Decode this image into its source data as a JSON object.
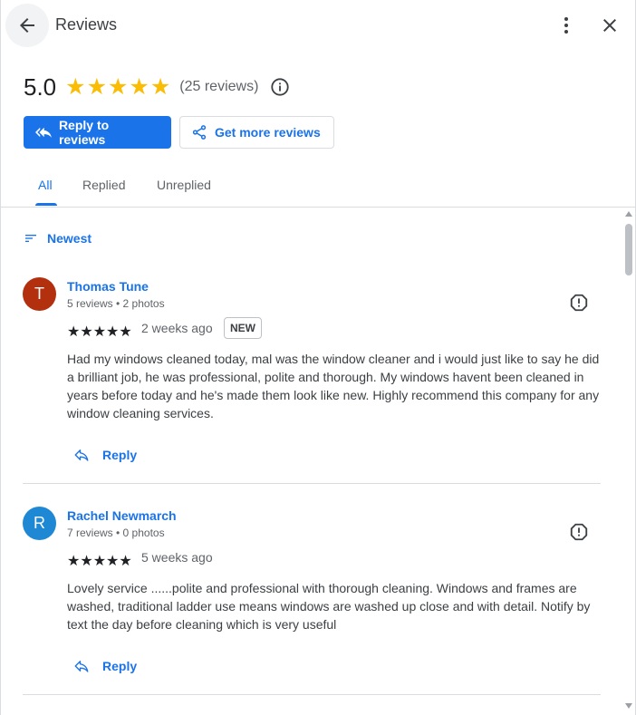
{
  "header": {
    "title": "Reviews",
    "back_icon": "arrow-back-icon",
    "more_icon": "more-vert-icon",
    "close_icon": "close-icon"
  },
  "summary": {
    "rating": "5.0",
    "stars": 5,
    "review_count": "(25 reviews)",
    "info_icon": "info-icon"
  },
  "actions": {
    "reply_to_reviews": "Reply to reviews",
    "get_more_reviews": "Get more reviews"
  },
  "tabs": [
    {
      "label": "All",
      "active": true
    },
    {
      "label": "Replied",
      "active": false
    },
    {
      "label": "Unreplied",
      "active": false
    }
  ],
  "sort": {
    "label": "Newest",
    "icon": "sort-icon"
  },
  "reviews": [
    {
      "initial": "T",
      "avatar_color": "#b3300f",
      "name": "Thomas Tune",
      "meta": "5 reviews • 2 photos",
      "stars": "★★★★★",
      "time": "2 weeks ago",
      "badge": "NEW",
      "text": "Had my windows cleaned today, mal was the window cleaner and i would just like to say he did a brilliant job, he was professional, polite and thorough. My windows havent been cleaned in years before today and he's made them look like new. Highly recommend this company for any window cleaning services.",
      "reply_label": "Reply"
    },
    {
      "initial": "R",
      "avatar_color": "#1e88d4",
      "name": "Rachel Newmarch",
      "meta": "7 reviews • 0 photos",
      "stars": "★★★★★",
      "time": "5 weeks ago",
      "text": "Lovely service ......polite and professional with thorough cleaning. Windows and frames are washed, traditional ladder use means windows are washed up close and with detail. Notify by text the day before cleaning which is very useful",
      "reply_label": "Reply"
    }
  ],
  "colors": {
    "accent": "#1a73e8",
    "star": "#fbbc04"
  }
}
